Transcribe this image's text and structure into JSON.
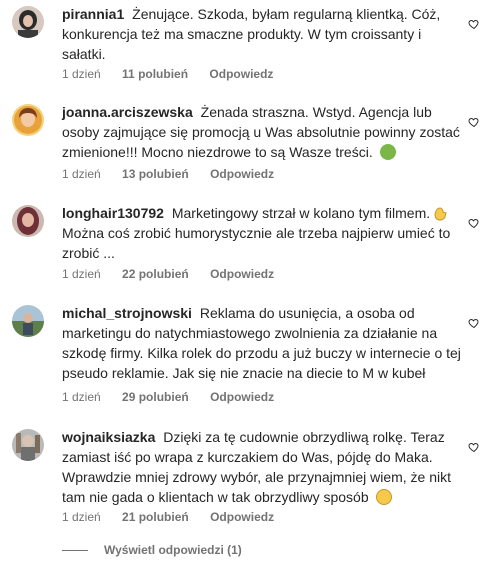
{
  "comments": [
    {
      "username": "pirannia1",
      "text": "Żenujące. Szkoda, byłam regularną klientką. Cóż, konkurencja też ma smaczne produkty. W tym croissanty i sałatki.",
      "time": "1 dzień",
      "likes": "11 polubień",
      "reply": "Odpowiedz",
      "avatar_color": "#2b2b2b"
    },
    {
      "username": "joanna.arciszewska",
      "text": "Żenada straszna. Wstyd. Agencja lub osoby zajmujące się promocją u Was absolutnie powinny zostać zmienione!!! Mocno niezdrowe to są Wasze treści.",
      "time": "1 dzień",
      "likes": "13 polubień",
      "reply": "Odpowiedz",
      "avatar_color": "#e9b84a"
    },
    {
      "username": "longhair130792",
      "text": "Marketingowy strzał w kolano tym filmem. .. Można coś zrobić humorystycznie ale trzeba najpierw umieć to zrobić ...",
      "time": "1 dzień",
      "likes": "22 polubień",
      "reply": "Odpowiedz",
      "avatar_color": "#7a4a4f"
    },
    {
      "username": "michal_strojnowski",
      "text": "Reklama do usunięcia, a osoba od marketingu do natychmiastowego zwolnienia za działanie na szkodę firmy. Kilka rolek do przodu a już buczy w internecie o tej pseudo reklamie. Jak się nie znacie na diecie to M w kubeł",
      "time": "1 dzień",
      "likes": "29 polubień",
      "reply": "Odpowiedz",
      "avatar_color": "#6d8a5c"
    },
    {
      "username": "wojnaiksiazka",
      "text": "Dzięki za tę cudownie obrzydliwą rolkę. Teraz zamiast iść po wrapa z kurczakiem do Was, pójdę do Maka. Wprawdzie mniej zdrowy wybór, ale przynajmniej wiem, że nikt tam nie gada o klientach w tak obrzydliwy sposób",
      "time": "1 dzień",
      "likes": "21 polubień",
      "reply": "Odpowiedz",
      "avatar_color": "#8f8f8f"
    }
  ],
  "view_replies": "Wyświetl odpowiedzi (1)",
  "icons": {
    "heart": "heart-icon",
    "emoji_sick": "nauseated-face-icon",
    "emoji_clap": "clapping-hand-icon",
    "emoji_smile": "smiling-face-icon"
  }
}
